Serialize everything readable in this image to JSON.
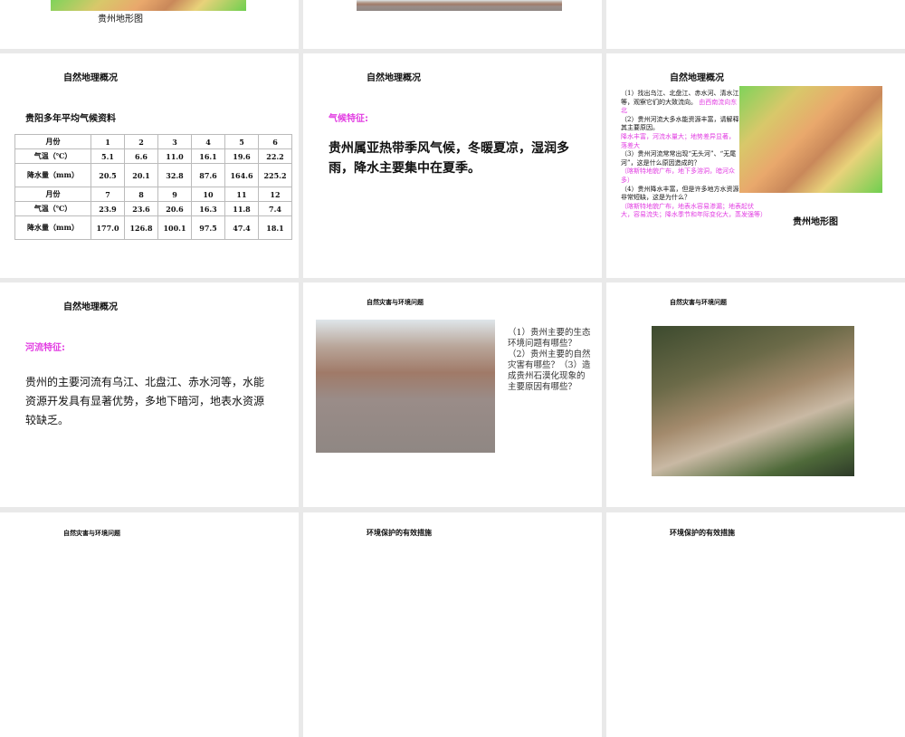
{
  "slides": {
    "s0": {
      "caption": "贵州地形图"
    },
    "s3": {
      "title": "自然地理概况",
      "subtitle": "贵阳多年平均气候资料",
      "table": {
        "rows": [
          [
            "月份",
            "1",
            "2",
            "3",
            "4",
            "5",
            "6"
          ],
          [
            "气温（℃）",
            "5.1",
            "6.6",
            "11.0",
            "16.1",
            "19.6",
            "22.2"
          ],
          [
            "降水量（mm）",
            "20.5",
            "20.1",
            "32.8",
            "87.6",
            "164.6",
            "225.2"
          ],
          [
            "月份",
            "7",
            "8",
            "9",
            "10",
            "11",
            "12"
          ],
          [
            "气温（℃）",
            "23.9",
            "23.6",
            "20.6",
            "16.3",
            "11.8",
            "7.4"
          ],
          [
            "降水量（mm）",
            "177.0",
            "126.8",
            "100.1",
            "97.5",
            "47.4",
            "18.1"
          ]
        ]
      }
    },
    "s4": {
      "title": "自然地理概况",
      "heading": "气候特征:",
      "body": "贵州属亚热带季风气候，冬暖夏凉，湿润多雨，降水主要集中在夏季。"
    },
    "s5": {
      "title": "自然地理概况",
      "q1": "（1）找出乌江、北盘江、赤水河、清水江等，观察它们的大致流向。",
      "a1": "由西南流向东北",
      "q2": "（2）贵州河流大多水能资源丰富，请解释其主要原因。",
      "a2": "降水丰富，河流水量大；地势差异显著，落差大",
      "q3": "（3）贵州河流常常出现“无头河”、“无尾河”，这是什么原因造成的？",
      "a3": "（喀斯特地貌广布，地下多溶洞，暗河众多）",
      "q4": "（4）贵州降水丰富，但是许多地方水资源非常短缺，这是为什么？",
      "a4": "（喀斯特地貌广布，地表水容易渗漏；地表起伏大，容易流失；降水季节和年际变化大，蒸发强等）",
      "caption": "贵州地形图"
    },
    "s6": {
      "title": "自然地理概况",
      "heading": "河流特征:",
      "body": "贵州的主要河流有乌江、北盘江、赤水河等，水能资源开发具有显著优势，多地下暗河，地表水资源较缺乏。"
    },
    "s7": {
      "title": "自然灾害与环境问题",
      "q": "（1）贵州主要的生态环境问题有哪些？（2）贵州主要的自然灾害有哪些？（3）造成贵州石漠化现象的主要原因有哪些？"
    },
    "s8": {
      "title": "自然灾害与环境问题"
    },
    "s9": {
      "title": "自然灾害与环境问题"
    },
    "s10": {
      "title": "环境保护的有效措施"
    },
    "s11": {
      "title": "环境保护的有效措施"
    }
  }
}
